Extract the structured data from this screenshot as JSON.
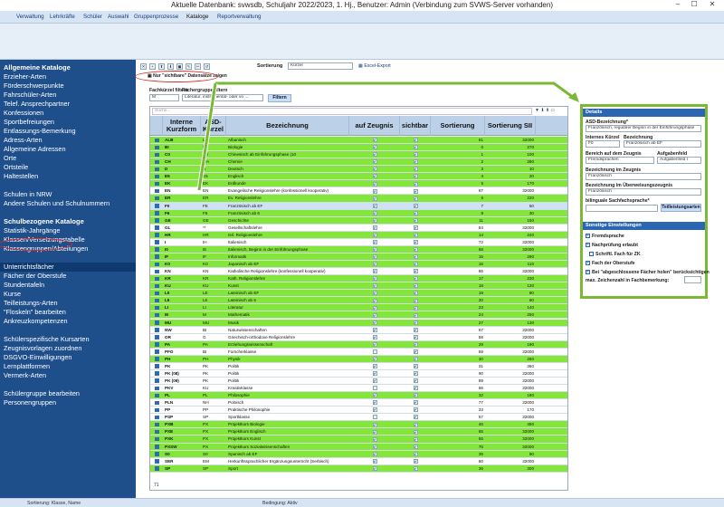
{
  "window": {
    "title": "Aktuelle Datenbank: svwsdb, Schuljahr 2022/2023, 1. Hj., Benutzer: Admin (Verbindung zum SVWS-Server vorhanden)",
    "min": "–",
    "max": "☐",
    "close": "✕"
  },
  "menu": [
    "Verwaltung",
    "Lehrkräfte",
    "Schüler",
    "Auswahl",
    "Gruppenprozesse",
    "Kataloge",
    "Reportverwaltung"
  ],
  "menu_active": "Kataloge",
  "sidebar": {
    "items": [
      {
        "label": "Allgemeine Kataloge",
        "heading": true
      },
      {
        "label": "Erzieher-Arten"
      },
      {
        "label": "Förderschwerpunkte"
      },
      {
        "label": "Fahrschüler-Arten"
      },
      {
        "label": "Telef. Ansprechpartner"
      },
      {
        "label": "Konfessionen"
      },
      {
        "label": "Sportbefreiungen"
      },
      {
        "label": "Entlassungs-Bemerkung"
      },
      {
        "label": "Adress-Arten"
      },
      {
        "label": "Allgemeine Adressen"
      },
      {
        "label": "Orte"
      },
      {
        "label": "Ortsteile"
      },
      {
        "label": "Haltestellen"
      },
      {
        "label": "",
        "gap": true
      },
      {
        "label": "Schulen in NRW"
      },
      {
        "label": "Andere Schulen und Schulnummern"
      },
      {
        "label": "",
        "gap": true
      },
      {
        "label": "Schulbezogene Kataloge",
        "heading": true
      },
      {
        "label": "Statistik-Jahrgänge"
      },
      {
        "label": "Klassen/Versetzungstabelle"
      },
      {
        "label": "Klassengruppen/Abteilungen"
      },
      {
        "label": "",
        "gap": true
      },
      {
        "label": "Unterrichtsfächer",
        "selected": true
      },
      {
        "label": "Fächer der Oberstufe"
      },
      {
        "label": "Stundentafeln"
      },
      {
        "label": "Kurse"
      },
      {
        "label": "Teilleistungs-Arten"
      },
      {
        "label": "\"Floskeln\" bearbeiten"
      },
      {
        "label": "Ankreuzkompetenzen"
      },
      {
        "label": "",
        "gap": true
      },
      {
        "label": "Schülerspezifische Kursarten"
      },
      {
        "label": "Zeugnisvorlagen zuordnen"
      },
      {
        "label": "DSGVO-Einwilligungen"
      },
      {
        "label": "Lernplattformen"
      },
      {
        "label": "Vermerk-Arten"
      },
      {
        "label": "",
        "gap": true
      },
      {
        "label": "Schülergruppe bearbeiten"
      },
      {
        "label": "Personengruppen"
      }
    ]
  },
  "toolbar": {
    "buttons": [
      "✕",
      "+",
      "⬆",
      "⬇",
      "◼",
      "✎",
      "✂",
      "↺"
    ],
    "sortierung_label": "Sortierung",
    "sortierung_value": "Kürzel",
    "excel_export": "Excel-Export",
    "only_visible": "Nur \"sichtbare\" Datensätze zeigen"
  },
  "filter": {
    "fachkuerzel_label": "Fachkürzel filtern",
    "fachkuerzel_value": "M",
    "faechergruppe_label": "Fächergruppe filtern",
    "faechergruppe_value": "Literatur, instrumental- oder vo ...",
    "filter_button": "Filtern",
    "search_placeholder": "Suche..."
  },
  "grid": {
    "headers": [
      "Interne Kurzform",
      "ASD-Kürzel",
      "Bezeichnung",
      "auf Zeugnis",
      "sichtbar",
      "Sortierung",
      "Sortierung SII"
    ],
    "footer_count": "71",
    "rows": [
      [
        "ALB",
        "LH",
        "Albanisch",
        1,
        1,
        "61",
        "32000",
        "g"
      ],
      [
        "BI",
        "BI",
        "Biologie",
        1,
        1,
        "0",
        "270",
        "g"
      ],
      [
        "C0",
        "C0",
        "Chinesisch ab Einführungsphase (10",
        1,
        1,
        "1",
        "100",
        "g"
      ],
      [
        "CH",
        "CH",
        "Chemie",
        1,
        1,
        "2",
        "280",
        "g"
      ],
      [
        "D",
        "D",
        "Deutsch",
        1,
        1,
        "3",
        "10",
        "g"
      ],
      [
        "E5",
        "E5",
        "Englisch",
        1,
        1,
        "4",
        "20",
        "g"
      ],
      [
        "EK",
        "EK",
        "Erdkunde",
        1,
        1,
        "5",
        "170",
        "g"
      ],
      [
        "EN",
        "EN",
        "Evangelische Religionslehre (konfessionell kooperativ)",
        1,
        1,
        "67",
        "32000",
        "w"
      ],
      [
        "ER",
        "ER",
        "Ev. Religionslehre",
        1,
        1,
        "6",
        "220",
        "g"
      ],
      [
        "F0",
        "FE",
        "Französisch ab EF",
        1,
        1,
        "7",
        "50",
        "sel"
      ],
      [
        "F6",
        "F6",
        "Französisch ab 6",
        1,
        1,
        "8",
        "30",
        "g"
      ],
      [
        "GE",
        "GE",
        "Geschichte",
        1,
        1,
        "11",
        "150",
        "g"
      ],
      [
        "GL",
        "**",
        "Gesellschaftslehre",
        1,
        1,
        "84",
        "32000",
        "w"
      ],
      [
        "HR",
        "HR",
        "Isrl. Religionslehre",
        1,
        1,
        "14",
        "240",
        "g"
      ],
      [
        "I",
        "IH",
        "Italienisch",
        1,
        1,
        "72",
        "32000",
        "w"
      ],
      [
        "I0",
        "IE",
        "Italienisch, Beginn in der Einführungsphase",
        1,
        1,
        "68",
        "32000",
        "g"
      ],
      [
        "IF",
        "IF",
        "Informatik",
        1,
        1,
        "15",
        "290",
        "g"
      ],
      [
        "K0",
        "K0",
        "Japanisch ab EF",
        1,
        1,
        "16",
        "110",
        "g"
      ],
      [
        "KN",
        "KN",
        "Katholische Religionslehre (konfessionell kooperativ)",
        1,
        1,
        "86",
        "32000",
        "w"
      ],
      [
        "KR",
        "KR",
        "Kath. Religionslehre",
        1,
        1,
        "17",
        "230",
        "g"
      ],
      [
        "KU",
        "KU",
        "Kunst",
        1,
        1,
        "18",
        "120",
        "g"
      ],
      [
        "L0",
        "LE",
        "Lateinisch ab EF",
        1,
        1,
        "19",
        "80",
        "g"
      ],
      [
        "L6",
        "L6",
        "Lateinisch ab 6",
        1,
        1,
        "20",
        "60",
        "g"
      ],
      [
        "LI",
        "LI",
        "Literatur",
        1,
        1,
        "23",
        "140",
        "g"
      ],
      [
        "M",
        "M",
        "Mathematik",
        1,
        1,
        "24",
        "250",
        "g"
      ],
      [
        "MU",
        "MU",
        "Musik",
        1,
        1,
        "27",
        "130",
        "g"
      ],
      [
        "NW",
        "BI",
        "Naturwissenschaften",
        1,
        1,
        "67",
        "32000",
        "w"
      ],
      [
        "OR",
        "G",
        "Griechisch-orthodoxe Religionslehre",
        1,
        1,
        "58",
        "32000",
        "w"
      ],
      [
        "PA",
        "PA",
        "Erziehungswissenschaft",
        1,
        1,
        "29",
        "190",
        "g"
      ],
      [
        "PFO",
        "BI",
        "Forscherklasse",
        0,
        1,
        "59",
        "32000",
        "w"
      ],
      [
        "PH",
        "PH",
        "Physik",
        1,
        1,
        "30",
        "260",
        "g"
      ],
      [
        "PK",
        "PK",
        "Politik",
        1,
        1,
        "31",
        "360",
        "w"
      ],
      [
        "PK (08)",
        "PK",
        "Politik",
        1,
        1,
        "90",
        "32000",
        "w"
      ],
      [
        "PK (09)",
        "PK",
        "Politik",
        1,
        1,
        "89",
        "32000",
        "w"
      ],
      [
        "PKV",
        "KU",
        "Kreativklasse",
        0,
        1,
        "66",
        "32000",
        "w"
      ],
      [
        "PL",
        "PL",
        "Philosophie",
        1,
        1,
        "32",
        "180",
        "g"
      ],
      [
        "PLN",
        "NH",
        "Polnisch",
        1,
        1,
        "77",
        "32000",
        "w"
      ],
      [
        "PP",
        "PP",
        "Praktische Philosophie",
        1,
        1,
        "33",
        "170",
        "w"
      ],
      [
        "PSP",
        "SP",
        "Sportklasse",
        0,
        1,
        "57",
        "32000",
        "w"
      ],
      [
        "PXB",
        "PX",
        "Projektkurs Biologie",
        1,
        1,
        "46",
        "450",
        "g"
      ],
      [
        "PXE",
        "PX",
        "Projektkurs Englisch",
        1,
        1,
        "65",
        "32000",
        "g"
      ],
      [
        "PXK",
        "PX",
        "Projektkurs Kunst",
        1,
        1,
        "55",
        "32000",
        "g"
      ],
      [
        "PXSW",
        "PX",
        "Projektkurs Sozialwissenschaften",
        1,
        1,
        "76",
        "32000",
        "g"
      ],
      [
        "S0",
        "S0",
        "Spanisch ab EF",
        1,
        1,
        "35",
        "90",
        "g"
      ],
      [
        "SER",
        "EM",
        "Herkunftssprachlicher Ergänzungsunterricht (Serbisch)",
        1,
        1,
        "60",
        "32000",
        "w"
      ],
      [
        "SP",
        "SP",
        "Sport",
        1,
        1,
        "36",
        "300",
        "g"
      ]
    ]
  },
  "details": {
    "title": "Details",
    "asd_label": "ASD-Bezeichnung*",
    "asd_value": "Französisch, regulärer Beginn in der Einführungsphase",
    "intern_label": "Internes Kürzel",
    "intern_value": "F0",
    "bez_label": "Bezeichnung",
    "bez_value": "Französisch ab EF",
    "bereich_label": "Bereich auf dem Zeugnis",
    "bereich_value": "Fremdsprachen",
    "aufgabenfeld_label": "Aufgabenfeld",
    "aufgabenfeld_value": "Aufgabenfeld I",
    "bez_zeugnis_label": "Bezeichnung im Zeugnis",
    "bez_zeugnis_value": "Französisch",
    "bez_ueberw_label": "Bezeichnung im Überweisungszeugnis",
    "bez_ueberw_value": "Französisch",
    "bilingual_label": "bilinguale Sachfachsprache*",
    "teilleistung_button": "Teilleistungsarten",
    "sonstige_title": "Sonstige Einstellungen",
    "checkboxes": [
      {
        "label": "Fremdsprache",
        "checked": true
      },
      {
        "label": "Nachprüfung erlaubt",
        "checked": true
      },
      {
        "label": "Schriftl. Fach für ZK",
        "checked": false
      },
      {
        "label": "Fach der Oberstufe",
        "checked": true
      },
      {
        "label": "Bei \"abgeschlossene Fächer holen\" berücksichtigen",
        "checked": true
      }
    ],
    "max_zeichen_label": "max. Zeichenzahl in Fachbemerkung:"
  },
  "statusbar": {
    "sort": "Sortierung: Klasse, Name",
    "bedingung": "Bedingung: Aktiv"
  },
  "colors": {
    "sidebar": "#1f4f8a",
    "row_green": "#84e63a",
    "accent": "#2a67b0",
    "highlight": "#7ab836",
    "annotation": "#d42a2a"
  }
}
